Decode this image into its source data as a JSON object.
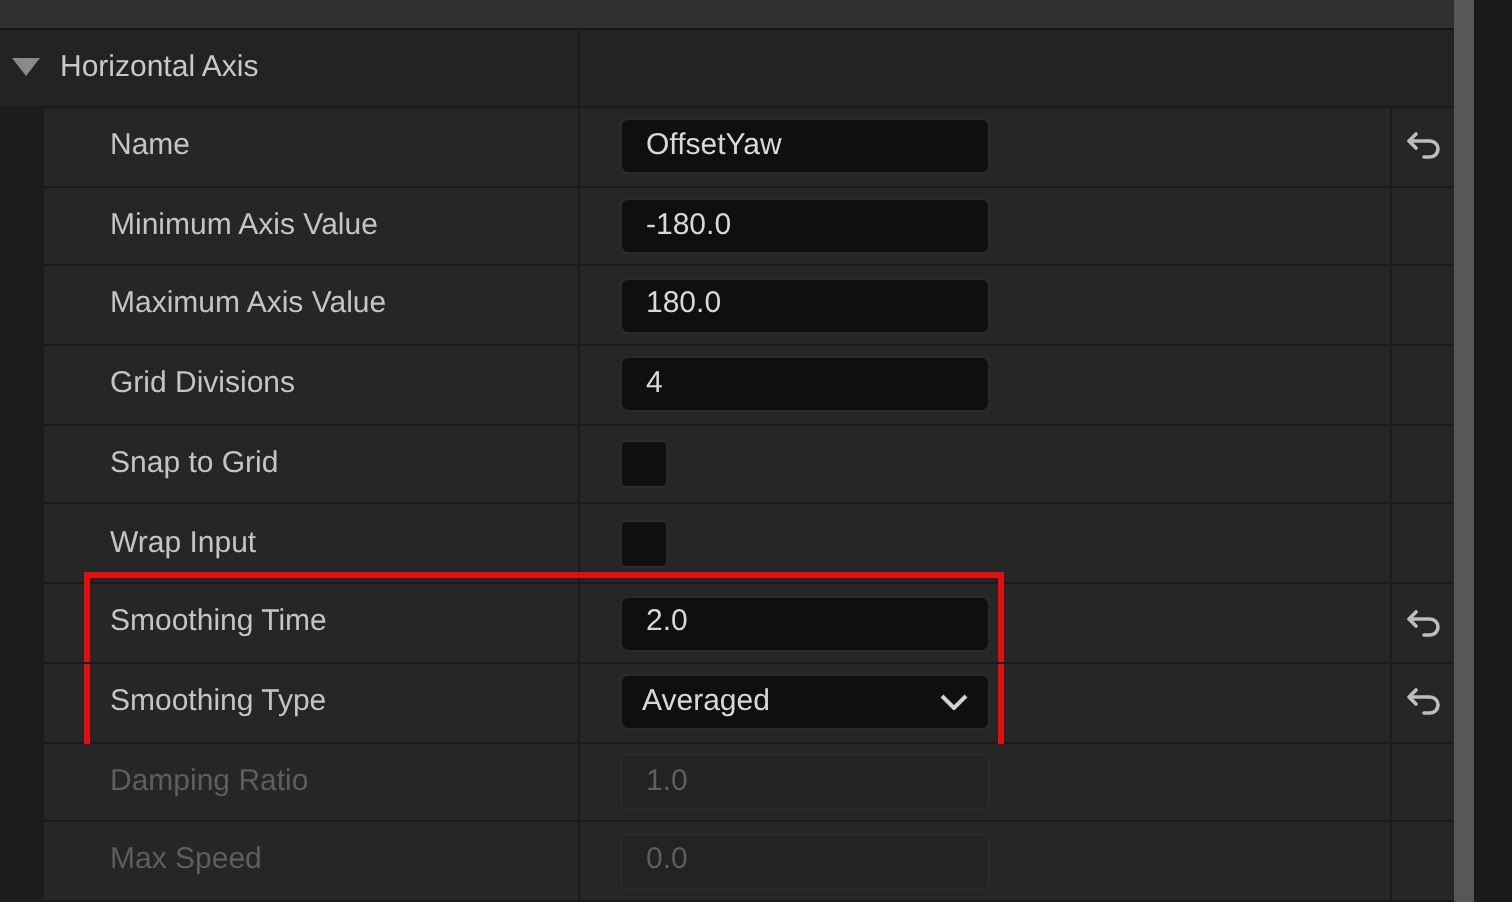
{
  "section": {
    "title": "Horizontal Axis",
    "expanded": true
  },
  "rows": [
    {
      "kind": "text",
      "label": "Name",
      "value": "OffsetYaw",
      "reset": true,
      "disabled": false,
      "highlighted": false
    },
    {
      "kind": "text",
      "label": "Minimum Axis Value",
      "value": "-180.0",
      "reset": false,
      "disabled": false,
      "highlighted": false
    },
    {
      "kind": "text",
      "label": "Maximum Axis Value",
      "value": "180.0",
      "reset": false,
      "disabled": false,
      "highlighted": false
    },
    {
      "kind": "text",
      "label": "Grid Divisions",
      "value": "4",
      "reset": false,
      "disabled": false,
      "highlighted": false
    },
    {
      "kind": "checkbox",
      "label": "Snap to Grid",
      "checked": false,
      "reset": false,
      "disabled": false,
      "highlighted": false
    },
    {
      "kind": "checkbox",
      "label": "Wrap Input",
      "checked": false,
      "reset": false,
      "disabled": false,
      "highlighted": false
    },
    {
      "kind": "text",
      "label": "Smoothing Time",
      "value": "2.0",
      "reset": true,
      "disabled": false,
      "highlighted": true
    },
    {
      "kind": "dropdown",
      "label": "Smoothing Type",
      "value": "Averaged",
      "reset": true,
      "disabled": false,
      "highlighted": true
    },
    {
      "kind": "text",
      "label": "Damping Ratio",
      "value": "1.0",
      "reset": false,
      "disabled": true,
      "highlighted": false
    },
    {
      "kind": "text",
      "label": "Max Speed",
      "value": "0.0",
      "reset": false,
      "disabled": true,
      "highlighted": false
    }
  ]
}
